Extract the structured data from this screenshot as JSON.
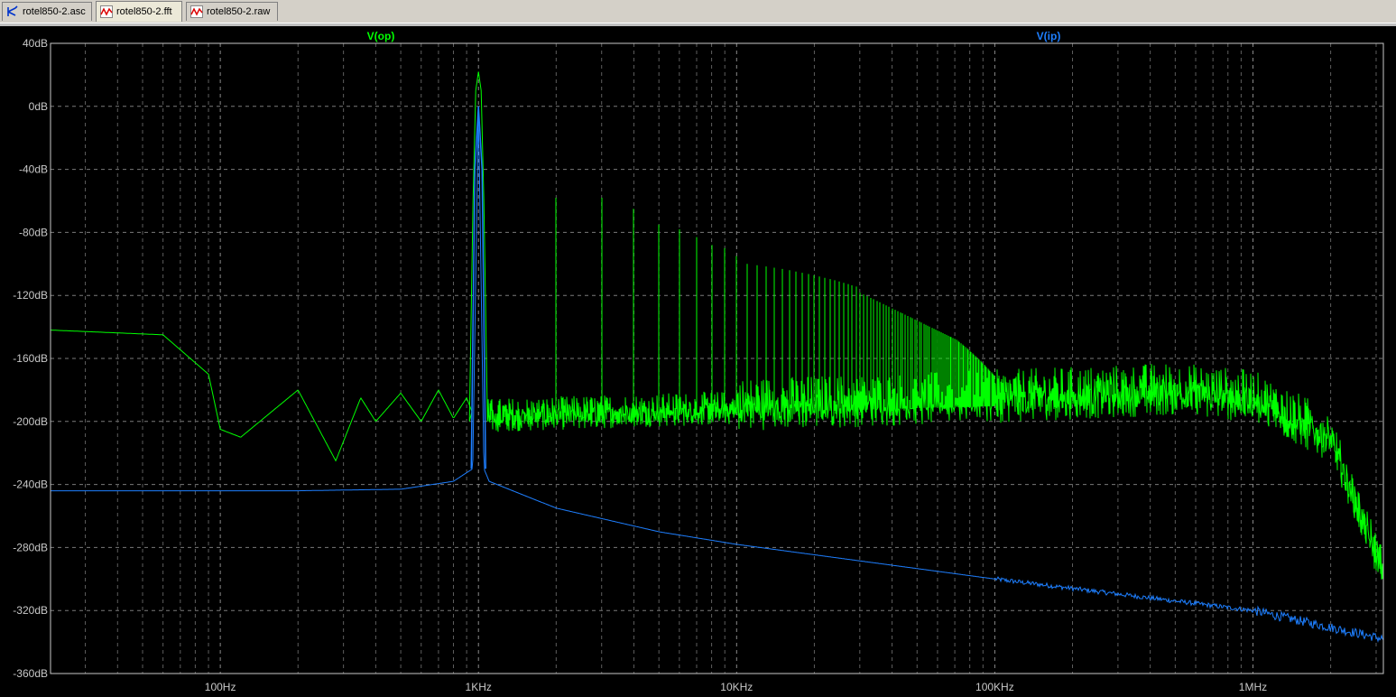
{
  "tabs": [
    {
      "label": "rotel850-2.asc",
      "icon": "schematic-icon",
      "active": false
    },
    {
      "label": "rotel850-2.fft",
      "icon": "waveform-icon",
      "active": true
    },
    {
      "label": "rotel850-2.raw",
      "icon": "waveform-icon",
      "active": false
    }
  ],
  "chart_data": {
    "type": "line",
    "x_scale": "log",
    "xlim": [
      22,
      3200000
    ],
    "ylim": [
      -360,
      40
    ],
    "y_ticks": [
      "40dB",
      "0dB",
      "-40dB",
      "-80dB",
      "-120dB",
      "-160dB",
      "-200dB",
      "-240dB",
      "-280dB",
      "-320dB",
      "-360dB"
    ],
    "x_ticks": [
      "100Hz",
      "1KHz",
      "10KHz",
      "100KHz",
      "1MHz"
    ],
    "grid": true,
    "series": [
      {
        "name": "V(op)",
        "color": "#00ff00",
        "baseline_x": [
          22,
          60,
          90,
          100,
          120,
          200,
          280,
          350,
          400,
          500,
          600,
          700,
          800,
          900,
          950
        ],
        "baseline_y": [
          -142,
          -145,
          -170,
          -205,
          -210,
          -180,
          -225,
          -185,
          -200,
          -182,
          -200,
          -180,
          -198,
          -185,
          -195
        ],
        "fundamental": {
          "x": 1000,
          "y": 22
        },
        "harmonic_peaks_y": [
          -58,
          -58,
          -65,
          -75,
          -78,
          -83,
          -88,
          -90,
          -95,
          -100
        ],
        "noise_floor": [
          [
            1000,
            -200
          ],
          [
            10000,
            -195
          ],
          [
            100000,
            -190
          ],
          [
            500000,
            -185
          ],
          [
            1000000,
            -190
          ],
          [
            2000000,
            -215
          ],
          [
            3200000,
            -300
          ]
        ]
      },
      {
        "name": "V(ip)",
        "color": "#1e7fff",
        "points_x": [
          22,
          200,
          500,
          800,
          950,
          1000,
          1050,
          1100,
          2000,
          5000,
          10000,
          100000,
          1000000,
          3200000
        ],
        "points_y": [
          -244,
          -244,
          -243,
          -238,
          -230,
          0,
          -230,
          -238,
          -255,
          -270,
          -278,
          -300,
          -320,
          -338
        ]
      }
    ]
  }
}
